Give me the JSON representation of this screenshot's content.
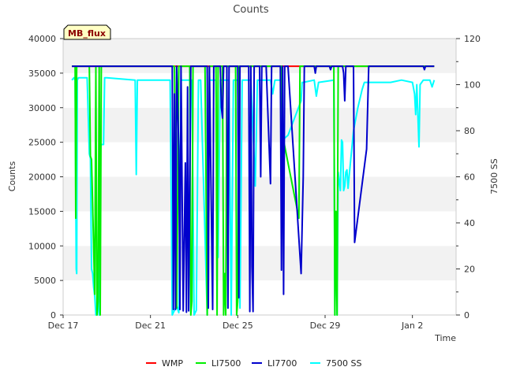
{
  "chart_data": {
    "type": "line",
    "title": "Counts",
    "xlabel": "Time",
    "ylabel": "Counts",
    "y2label": "7500 SS",
    "tag": "MB_flux",
    "xlim": [
      0,
      18
    ],
    "ylim": [
      0,
      40000
    ],
    "y2lim": [
      0,
      120
    ],
    "xticks": [
      {
        "v": 0,
        "label": "Dec 17"
      },
      {
        "v": 4,
        "label": "Dec 21"
      },
      {
        "v": 8,
        "label": "Dec 25"
      },
      {
        "v": 12,
        "label": "Dec 29"
      },
      {
        "v": 16,
        "label": "Jan 2"
      }
    ],
    "yticks": [
      0,
      5000,
      10000,
      15000,
      20000,
      25000,
      30000,
      35000,
      40000
    ],
    "y2ticks": [
      0,
      20,
      40,
      60,
      80,
      100,
      120
    ],
    "grid": "horizontal bands",
    "legend_position": "bottom",
    "series": [
      {
        "name": "WMP",
        "color": "#ff0000",
        "axis": "left",
        "points": [
          [
            0.4,
            36000
          ],
          [
            17,
            36000
          ]
        ]
      },
      {
        "name": "LI7500",
        "color": "#00ee00",
        "axis": "left",
        "points": [
          [
            0.4,
            36000
          ],
          [
            0.55,
            36000
          ],
          [
            0.58,
            14000
          ],
          [
            0.62,
            36000
          ],
          [
            1.2,
            36000
          ],
          [
            1.25,
            23000
          ],
          [
            1.3,
            22500
          ],
          [
            1.45,
            3000
          ],
          [
            1.5,
            36000
          ],
          [
            1.55,
            0
          ],
          [
            1.6,
            2000
          ],
          [
            1.65,
            36000
          ],
          [
            1.7,
            0
          ],
          [
            1.75,
            36000
          ],
          [
            5.1,
            36000
          ],
          [
            5.2,
            1000
          ],
          [
            5.3,
            36000
          ],
          [
            5.8,
            36000
          ],
          [
            5.85,
            0
          ],
          [
            5.9,
            2000
          ],
          [
            5.95,
            36000
          ],
          [
            6.5,
            36000
          ],
          [
            6.6,
            0
          ],
          [
            6.7,
            36000
          ],
          [
            7.0,
            36000
          ],
          [
            7.05,
            0
          ],
          [
            7.1,
            36000
          ],
          [
            7.3,
            36000
          ],
          [
            7.35,
            0
          ],
          [
            7.4,
            6000
          ],
          [
            7.45,
            0
          ],
          [
            7.5,
            36000
          ],
          [
            7.9,
            36000
          ],
          [
            7.95,
            0
          ],
          [
            8.0,
            2000
          ],
          [
            8.05,
            36000
          ],
          [
            10.0,
            36000
          ],
          [
            10.05,
            26000
          ],
          [
            10.8,
            14000
          ],
          [
            10.85,
            36000
          ],
          [
            12.4,
            36000
          ],
          [
            12.45,
            0
          ],
          [
            12.5,
            15000
          ],
          [
            12.55,
            0
          ],
          [
            12.6,
            36000
          ],
          [
            13.5,
            36000
          ],
          [
            13.55,
            36000
          ],
          [
            17,
            36000
          ]
        ]
      },
      {
        "name": "LI7700",
        "color": "#0000cc",
        "axis": "left",
        "points": [
          [
            0.4,
            36000
          ],
          [
            5.0,
            36000
          ],
          [
            5.05,
            800
          ],
          [
            5.1,
            32000
          ],
          [
            5.15,
            800
          ],
          [
            5.2,
            36000
          ],
          [
            5.3,
            24000
          ],
          [
            5.35,
            800
          ],
          [
            5.4,
            36000
          ],
          [
            5.5,
            600
          ],
          [
            5.6,
            22000
          ],
          [
            5.65,
            400
          ],
          [
            5.7,
            33000
          ],
          [
            5.75,
            600
          ],
          [
            5.85,
            36000
          ],
          [
            6.6,
            36000
          ],
          [
            6.65,
            1000
          ],
          [
            6.7,
            36000
          ],
          [
            6.85,
            800
          ],
          [
            6.9,
            36000
          ],
          [
            7.2,
            36000
          ],
          [
            7.25,
            30000
          ],
          [
            7.3,
            28500
          ],
          [
            7.35,
            36000
          ],
          [
            7.5,
            36000
          ],
          [
            7.55,
            1000
          ],
          [
            7.6,
            36000
          ],
          [
            8.0,
            36000
          ],
          [
            8.05,
            2500
          ],
          [
            8.1,
            36000
          ],
          [
            8.5,
            36000
          ],
          [
            8.55,
            500
          ],
          [
            8.6,
            36000
          ],
          [
            8.65,
            7000
          ],
          [
            8.7,
            500
          ],
          [
            8.75,
            36000
          ],
          [
            9.0,
            36000
          ],
          [
            9.05,
            20000
          ],
          [
            9.1,
            36000
          ],
          [
            9.3,
            36000
          ],
          [
            9.5,
            19000
          ],
          [
            9.55,
            36000
          ],
          [
            9.95,
            36000
          ],
          [
            10.0,
            6500
          ],
          [
            10.05,
            36000
          ],
          [
            10.1,
            3000
          ],
          [
            10.15,
            36000
          ],
          [
            10.3,
            36000
          ],
          [
            10.9,
            6000
          ],
          [
            11.0,
            20000
          ],
          [
            11.05,
            36000
          ],
          [
            11.5,
            36000
          ],
          [
            11.55,
            35000
          ],
          [
            11.6,
            36000
          ],
          [
            12.2,
            36000
          ],
          [
            12.25,
            35500
          ],
          [
            12.3,
            36000
          ],
          [
            12.8,
            36000
          ],
          [
            12.85,
            35000
          ],
          [
            12.9,
            31000
          ],
          [
            12.95,
            36000
          ],
          [
            13.3,
            36000
          ],
          [
            13.35,
            10500
          ],
          [
            13.9,
            24000
          ],
          [
            14.0,
            36000
          ],
          [
            16.5,
            36000
          ],
          [
            16.55,
            35500
          ],
          [
            16.6,
            36000
          ],
          [
            17,
            36000
          ]
        ]
      },
      {
        "name": "7500 SS",
        "color": "#00ffff",
        "axis": "right",
        "points": [
          [
            0.4,
            102
          ],
          [
            0.5,
            103
          ],
          [
            0.55,
            102
          ],
          [
            0.6,
            20
          ],
          [
            0.62,
            18
          ],
          [
            0.65,
            102
          ],
          [
            0.7,
            103
          ],
          [
            1.1,
            103
          ],
          [
            1.2,
            70
          ],
          [
            1.25,
            68
          ],
          [
            1.3,
            20
          ],
          [
            1.35,
            18
          ],
          [
            1.4,
            12
          ],
          [
            1.45,
            8
          ],
          [
            1.5,
            0
          ],
          [
            1.6,
            4
          ],
          [
            1.65,
            0
          ],
          [
            1.7,
            72
          ],
          [
            1.75,
            74
          ],
          [
            1.85,
            74
          ],
          [
            1.9,
            103
          ],
          [
            2.0,
            103
          ],
          [
            3.3,
            102
          ],
          [
            3.35,
            61
          ],
          [
            3.4,
            102
          ],
          [
            4.5,
            102
          ],
          [
            4.9,
            102
          ],
          [
            5.0,
            0
          ],
          [
            5.2,
            4
          ],
          [
            5.3,
            1
          ],
          [
            5.4,
            102
          ],
          [
            5.9,
            102
          ],
          [
            6.0,
            0
          ],
          [
            6.1,
            2
          ],
          [
            6.2,
            102
          ],
          [
            6.3,
            102
          ],
          [
            6.6,
            0
          ],
          [
            6.7,
            102
          ],
          [
            7.0,
            102
          ],
          [
            7.1,
            25
          ],
          [
            7.2,
            102
          ],
          [
            7.6,
            102
          ],
          [
            7.7,
            0
          ],
          [
            7.8,
            102
          ],
          [
            8.0,
            102
          ],
          [
            8.1,
            3
          ],
          [
            8.2,
            102
          ],
          [
            8.6,
            102
          ],
          [
            8.7,
            80
          ],
          [
            8.8,
            56
          ],
          [
            8.9,
            102
          ],
          [
            9.5,
            102
          ],
          [
            9.6,
            96
          ],
          [
            9.7,
            102
          ],
          [
            10.0,
            102
          ],
          [
            10.05,
            76
          ],
          [
            10.3,
            78
          ],
          [
            10.9,
            93
          ],
          [
            10.95,
            101
          ],
          [
            11.0,
            101
          ],
          [
            11.5,
            102
          ],
          [
            11.6,
            95
          ],
          [
            11.7,
            101
          ],
          [
            12.4,
            102
          ],
          [
            12.45,
            0
          ],
          [
            12.5,
            40
          ],
          [
            12.55,
            0
          ],
          [
            12.6,
            62
          ],
          [
            12.7,
            54
          ],
          [
            12.75,
            76
          ],
          [
            12.8,
            75
          ],
          [
            12.85,
            54
          ],
          [
            12.9,
            56
          ],
          [
            12.95,
            62
          ],
          [
            13.0,
            63
          ],
          [
            13.05,
            55
          ],
          [
            13.1,
            60
          ],
          [
            13.2,
            70
          ],
          [
            13.3,
            80
          ],
          [
            13.5,
            90
          ],
          [
            13.7,
            98
          ],
          [
            13.8,
            101
          ],
          [
            14.0,
            101
          ],
          [
            15.0,
            101
          ],
          [
            15.5,
            102
          ],
          [
            16.0,
            101
          ],
          [
            16.1,
            96
          ],
          [
            16.15,
            87
          ],
          [
            16.2,
            100
          ],
          [
            16.3,
            73
          ],
          [
            16.35,
            100
          ],
          [
            16.5,
            102
          ],
          [
            16.8,
            102
          ],
          [
            16.9,
            99
          ],
          [
            17,
            102
          ]
        ]
      }
    ]
  }
}
